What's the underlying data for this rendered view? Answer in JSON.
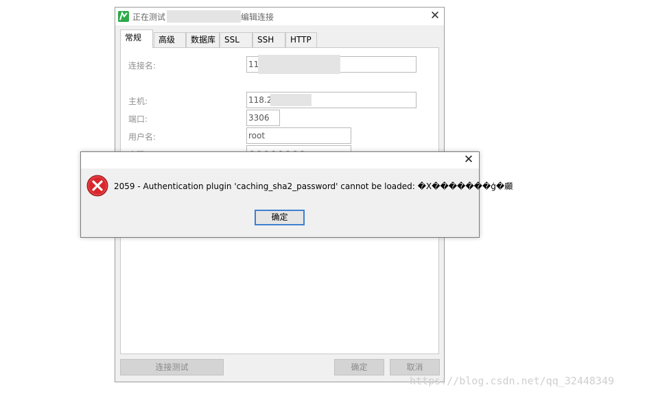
{
  "connection_dialog": {
    "title": "正在测试",
    "title_suffix": "编辑连接",
    "tabs": [
      "常规",
      "高级",
      "数据库",
      "SSL",
      "SSH",
      "HTTP"
    ],
    "fields": {
      "connection_name": {
        "label": "连接名:",
        "value": "11"
      },
      "host": {
        "label": "主机:",
        "value": "118.2"
      },
      "port": {
        "label": "端口:",
        "value": "3306"
      },
      "username": {
        "label": "用户名:",
        "value": "root"
      },
      "password": {
        "label": "密码:",
        "value": "●●●●●●●●"
      }
    },
    "buttons": {
      "test": "连接测试",
      "ok": "确定",
      "cancel": "取消"
    }
  },
  "error_dialog": {
    "message": "2059 - Authentication plugin 'caching_sha2_password' cannot be loaded: �X�������ģ�顣",
    "ok_label": "确定",
    "icon": "error-icon"
  },
  "watermark": "https://blog.csdn.net/qq_32448349",
  "colors": {
    "accent": "#3c7fd0",
    "error_red": "#d9262c",
    "app_green": "#2eaa4a"
  }
}
